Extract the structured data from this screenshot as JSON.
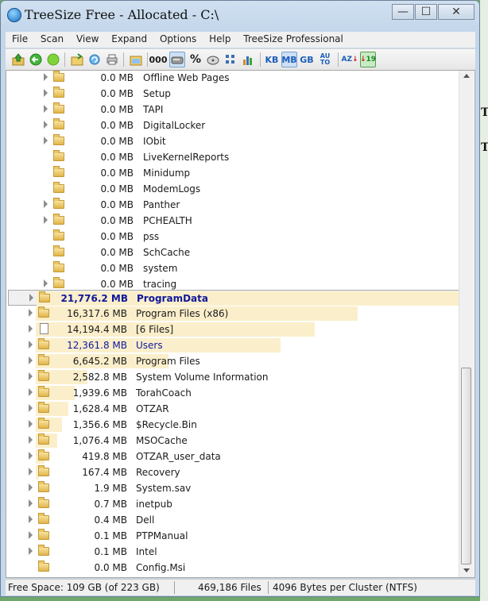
{
  "window": {
    "title": "TreeSize Free - Allocated - C:\\",
    "buttons": {
      "minimize": "—",
      "maximize": "☐",
      "close": "✕"
    }
  },
  "menu": [
    "File",
    "Scan",
    "View",
    "Expand",
    "Options",
    "Help",
    "TreeSize Professional"
  ],
  "toolbar": {
    "unit_kb": "KB",
    "unit_mb": "MB",
    "unit_gb": "GB",
    "unit_auto": "AU TO",
    "percent": "%",
    "count": "000",
    "sort_az": "AZ",
    "sort_19": "19",
    "selected_unit": "MB"
  },
  "tree": {
    "subfolders": [
      {
        "size": "0.0 MB",
        "name": "Offline Web Pages",
        "expandable": true
      },
      {
        "size": "0.0 MB",
        "name": "Setup",
        "expandable": true
      },
      {
        "size": "0.0 MB",
        "name": "TAPI",
        "expandable": true
      },
      {
        "size": "0.0 MB",
        "name": "DigitalLocker",
        "expandable": true
      },
      {
        "size": "0.0 MB",
        "name": "IObit",
        "expandable": true
      },
      {
        "size": "0.0 MB",
        "name": "LiveKernelReports",
        "expandable": false
      },
      {
        "size": "0.0 MB",
        "name": "Minidump",
        "expandable": false
      },
      {
        "size": "0.0 MB",
        "name": "ModemLogs",
        "expandable": false
      },
      {
        "size": "0.0 MB",
        "name": "Panther",
        "expandable": true
      },
      {
        "size": "0.0 MB",
        "name": "PCHEALTH",
        "expandable": true
      },
      {
        "size": "0.0 MB",
        "name": "pss",
        "expandable": false
      },
      {
        "size": "0.0 MB",
        "name": "SchCache",
        "expandable": false
      },
      {
        "size": "0.0 MB",
        "name": "system",
        "expandable": false
      },
      {
        "size": "0.0 MB",
        "name": "tracing",
        "expandable": true
      }
    ],
    "folders": [
      {
        "size": "21,776.2 MB",
        "name": "ProgramData",
        "fill": 1.0,
        "selected": true,
        "style": "blue-bold",
        "icon": "folder"
      },
      {
        "size": "16,317.6 MB",
        "name": "Program Files (x86)",
        "fill": 0.75,
        "style": "normal",
        "icon": "folder"
      },
      {
        "size": "14,194.4 MB",
        "name": "[6 Files]",
        "fill": 0.65,
        "style": "normal",
        "icon": "file"
      },
      {
        "size": "12,361.8 MB",
        "name": "Users",
        "fill": 0.57,
        "style": "blue",
        "icon": "folder"
      },
      {
        "size": "6,645.2 MB",
        "name": "Program Files",
        "fill": 0.31,
        "style": "normal",
        "icon": "folder"
      },
      {
        "size": "2,582.8 MB",
        "name": "System Volume Information",
        "fill": 0.12,
        "style": "normal",
        "icon": "folder"
      },
      {
        "size": "1,939.6 MB",
        "name": "TorahCoach",
        "fill": 0.09,
        "style": "normal",
        "icon": "folder"
      },
      {
        "size": "1,628.4 MB",
        "name": "OTZAR",
        "fill": 0.075,
        "style": "normal",
        "icon": "folder"
      },
      {
        "size": "1,356.6 MB",
        "name": "$Recycle.Bin",
        "fill": 0.062,
        "style": "normal",
        "icon": "folder"
      },
      {
        "size": "1,076.4 MB",
        "name": "MSOCache",
        "fill": 0.05,
        "style": "normal",
        "icon": "folder"
      },
      {
        "size": "419.8 MB",
        "name": "OTZAR_user_data",
        "fill": 0.02,
        "style": "normal",
        "icon": "folder"
      },
      {
        "size": "167.4 MB",
        "name": "Recovery",
        "fill": 0.008,
        "style": "normal",
        "icon": "folder"
      },
      {
        "size": "1.9 MB",
        "name": "System.sav",
        "fill": 0.0,
        "style": "normal",
        "icon": "folder"
      },
      {
        "size": "0.7 MB",
        "name": "inetpub",
        "fill": 0.0,
        "style": "normal",
        "icon": "folder"
      },
      {
        "size": "0.4 MB",
        "name": "Dell",
        "fill": 0.0,
        "style": "normal",
        "icon": "folder"
      },
      {
        "size": "0.1 MB",
        "name": "PTPManual",
        "fill": 0.0,
        "style": "normal",
        "icon": "folder"
      },
      {
        "size": "0.1 MB",
        "name": "Intel",
        "fill": 0.0,
        "style": "normal",
        "icon": "folder"
      },
      {
        "size": "0.0 MB",
        "name": "Config.Msi",
        "fill": 0.0,
        "style": "normal",
        "icon": "folder"
      }
    ]
  },
  "status": {
    "free_space": "Free Space: 109 GB  (of 223 GB)",
    "files": "469,186  Files",
    "cluster": "4096 Bytes per Cluster (NTFS)"
  },
  "colors": {
    "bar_fill": "#fbefcb",
    "highlight_text": "#10189a",
    "window_frame": "#c5d7ea"
  },
  "background_app": {
    "visible_glyphs": [
      "T",
      "T"
    ]
  }
}
